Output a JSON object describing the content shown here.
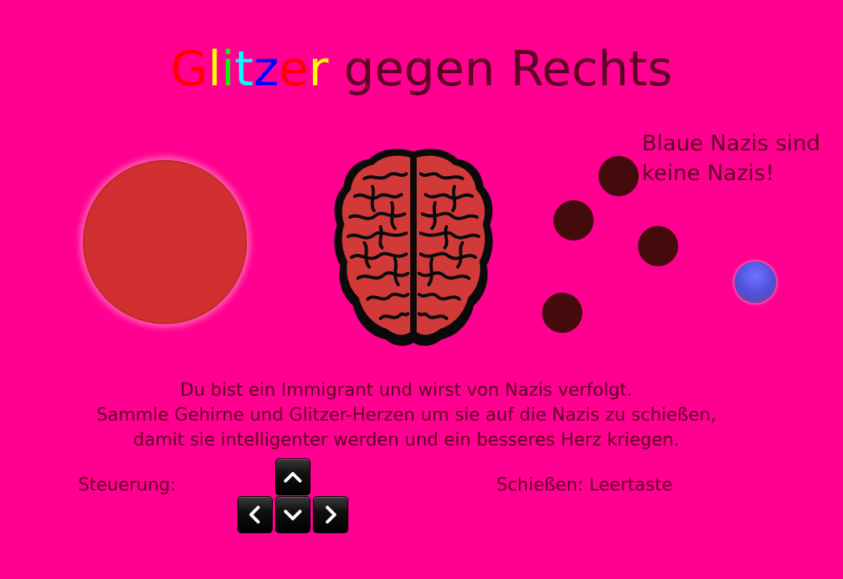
{
  "title": {
    "letters": [
      {
        "char": "G",
        "color": "#ff0000"
      },
      {
        "char": "l",
        "color": "#ffff00"
      },
      {
        "char": "i",
        "color": "#00ff00"
      },
      {
        "char": "t",
        "color": "#00ffff"
      },
      {
        "char": "z",
        "color": "#0000ff"
      },
      {
        "char": "e",
        "color": "#ff0000"
      },
      {
        "char": "r",
        "color": "#ffff00"
      }
    ],
    "rest": " gegen Rechts"
  },
  "hint": {
    "line1": "Blaue Nazis sind",
    "line2": "keine Nazis!"
  },
  "instructions": {
    "line1": "Du bist ein Immigrant und wirst von Nazis verfolgt.",
    "line2": "Sammle Gehirne und Glitzer-Herzen um sie auf die Nazis zu schießen,",
    "line3": "damit sie intelligenter werden und ein besseres Herz kriegen."
  },
  "controls": {
    "label": "Steuerung:",
    "keys": [
      "arrow-up",
      "arrow-left",
      "arrow-down",
      "arrow-right"
    ]
  },
  "shoot": {
    "label": "Schießen: Leertaste"
  },
  "colors": {
    "background": "#ff0090",
    "text": "#5a0022",
    "player": "#d23030",
    "nazi": "#430b0b",
    "blue_nazi": "#4f4fd8"
  }
}
